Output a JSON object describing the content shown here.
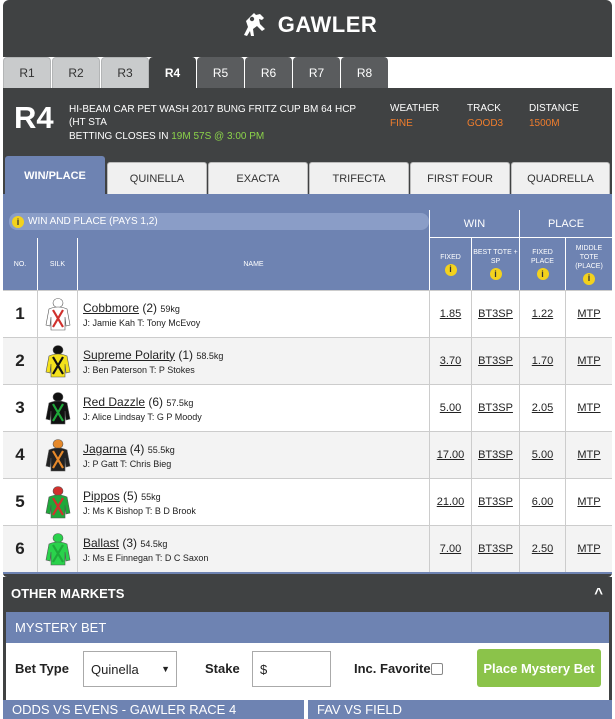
{
  "venue": {
    "name": "GAWLER",
    "logo_icon": "racehorse-icon"
  },
  "race_tabs": [
    {
      "label": "R1"
    },
    {
      "label": "R2"
    },
    {
      "label": "R3"
    },
    {
      "label": "R4"
    },
    {
      "label": "R5"
    },
    {
      "label": "R6"
    },
    {
      "label": "R7"
    },
    {
      "label": "R8"
    }
  ],
  "race": {
    "number": "R4",
    "name": "HI-BEAM CAR PET WASH 2017 BUNG FRITZ CUP BM 64 HCP (HT STA",
    "closes_label": "BETTING CLOSES IN",
    "closes_value": "19M 57S @ 3:00 PM",
    "weather_label": "WEATHER",
    "weather_value": "FINE",
    "track_label": "TRACK",
    "track_value": "GOOD3",
    "distance_label": "DISTANCE",
    "distance_value": "1500M"
  },
  "bet_tabs": [
    {
      "label": "WIN/PLACE"
    },
    {
      "label": "QUINELLA"
    },
    {
      "label": "EXACTA"
    },
    {
      "label": "TRIFECTA"
    },
    {
      "label": "FIRST FOUR"
    },
    {
      "label": "QUADRELLA"
    }
  ],
  "grid": {
    "pays_label": "WIN AND PLACE (PAYS 1,2)",
    "win_group": "WIN",
    "place_group": "PLACE",
    "col_no": "NO.",
    "col_silk": "SILK",
    "col_name": "NAME",
    "col_fixed": "FIXED",
    "col_best": "BEST TOTE + SP",
    "col_pfixed": "FIXED PLACE",
    "col_mtp": "MIDDLE TOTE (PLACE)",
    "info_glyph": "i"
  },
  "runners": [
    {
      "no": "1",
      "name": "Cobbmore",
      "barrier": "(2)",
      "weight": "59kg",
      "jt": "J: Jamie Kah T: Tony McEvoy",
      "fixed": "1.85",
      "best": "BT3SP",
      "pfixed": "1.22",
      "mtp": "MTP",
      "silk": {
        "body": "#ffffff",
        "trim": "#d0312d",
        "cap": "#ffffff"
      }
    },
    {
      "no": "2",
      "name": "Supreme Polarity",
      "barrier": "(1)",
      "weight": "58.5kg",
      "jt": "J: Ben Paterson T: P Stokes",
      "fixed": "3.70",
      "best": "BT3SP",
      "pfixed": "1.70",
      "mtp": "MTP",
      "silk": {
        "body": "#f4e11c",
        "trim": "#111111",
        "cap": "#111111"
      }
    },
    {
      "no": "3",
      "name": "Red Dazzle",
      "barrier": "(6)",
      "weight": "57.5kg",
      "jt": "J: Alice Lindsay T: G P Moody",
      "fixed": "5.00",
      "best": "BT3SP",
      "pfixed": "2.05",
      "mtp": "MTP",
      "silk": {
        "body": "#111111",
        "trim": "#1fa83a",
        "cap": "#111111"
      }
    },
    {
      "no": "4",
      "name": "Jagarna",
      "barrier": "(4)",
      "weight": "55.5kg",
      "jt": "J: P Gatt T: Chris Bieg",
      "fixed": "17.00",
      "best": "BT3SP",
      "pfixed": "5.00",
      "mtp": "MTP",
      "silk": {
        "body": "#222222",
        "trim": "#e6892a",
        "cap": "#e6892a"
      }
    },
    {
      "no": "5",
      "name": "Pippos",
      "barrier": "(5)",
      "weight": "55kg",
      "jt": "J: Ms K Bishop T: B D Brook",
      "fixed": "21.00",
      "best": "BT3SP",
      "pfixed": "6.00",
      "mtp": "MTP",
      "silk": {
        "body": "#1fa83a",
        "trim": "#d0312d",
        "cap": "#d0312d"
      }
    },
    {
      "no": "6",
      "name": "Ballast",
      "barrier": "(3)",
      "weight": "54.5kg",
      "jt": "J: Ms E Finnegan T: D C Saxon",
      "fixed": "7.00",
      "best": "BT3SP",
      "pfixed": "2.50",
      "mtp": "MTP",
      "silk": {
        "body": "#2ad24c",
        "trim": "#1fa83a",
        "cap": "#2ad24c"
      }
    }
  ],
  "other_markets": {
    "title": "OTHER MARKETS",
    "chevron": "^",
    "mystery": {
      "title": "MYSTERY BET",
      "bet_type_label": "Bet Type",
      "bet_type_value": "Quinella",
      "stake_label": "Stake",
      "stake_prefix": "$",
      "inc_fav_label": "Inc. Favorite",
      "place_label": "Place Mystery Bet"
    },
    "odds_vs_evens": "ODDS VS EVENS - GAWLER RACE 4",
    "fav_vs_field": "FAV VS FIELD"
  }
}
